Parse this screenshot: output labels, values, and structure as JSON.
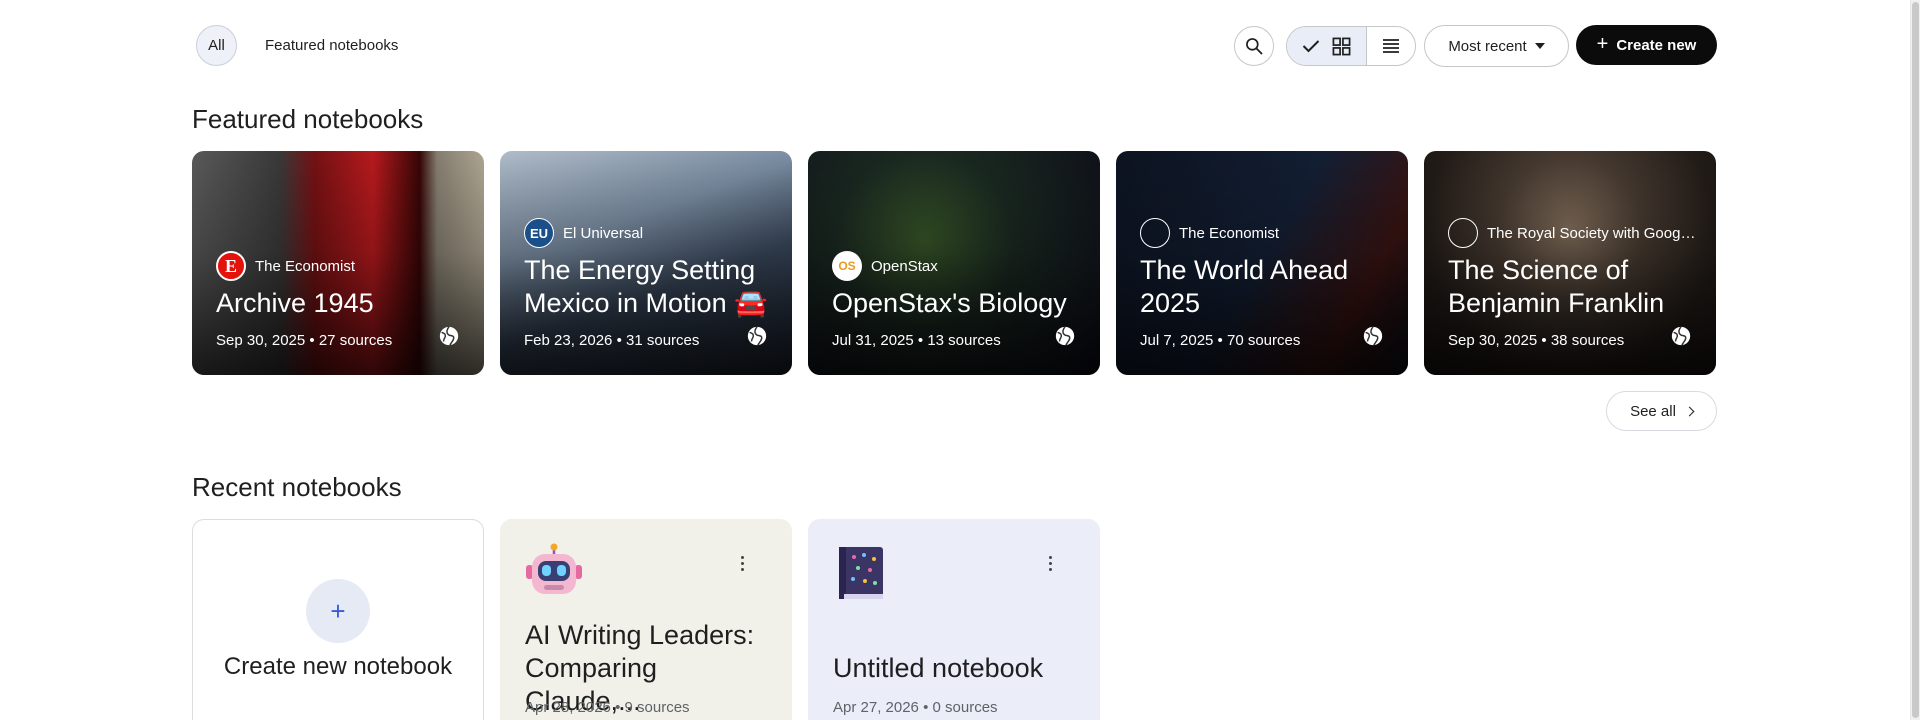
{
  "filters": {
    "all_label": "All",
    "featured_label": "Featured notebooks"
  },
  "toolbar": {
    "sort_label": "Most recent",
    "create_label": "Create new"
  },
  "featured": {
    "title": "Featured notebooks",
    "cards": [
      {
        "publisher": "The Economist",
        "publisher_logo": "E",
        "title": "Archive 1945",
        "date": "Sep 30, 2025",
        "sources": "27 sources"
      },
      {
        "publisher": "El Universal",
        "publisher_logo": "EU",
        "title": "The Energy Setting Mexico in Motion 🚘🚆⚡",
        "date": "Feb 23, 2026",
        "sources": "31 sources"
      },
      {
        "publisher": "OpenStax",
        "publisher_logo": "OS",
        "title": "OpenStax's Biology",
        "date": "Jul 31, 2025",
        "sources": "13 sources"
      },
      {
        "publisher": "The Economist",
        "publisher_logo": "",
        "title": "The World Ahead 2025",
        "date": "Jul 7, 2025",
        "sources": "70 sources"
      },
      {
        "publisher": "The Royal Society with Google...",
        "publisher_logo": "",
        "title": "The Science of Benjamin Franklin",
        "date": "Sep 30, 2025",
        "sources": "38 sources"
      }
    ],
    "see_all": "See all"
  },
  "recent": {
    "title": "Recent notebooks",
    "create_label": "Create new notebook",
    "cards": [
      {
        "icon": "robot-emoji",
        "title": "AI Writing Leaders: Comparing Claude,...",
        "date": "Apr 28, 2026",
        "sources": "9 sources"
      },
      {
        "icon": "book-emoji",
        "title": "Untitled notebook",
        "date": "Apr 27, 2026",
        "sources": "0 sources"
      }
    ]
  },
  "meta_separator": " • ",
  "colors": {
    "create_button": "#0b0b0b",
    "grid_toggle_active": "#e8edf7",
    "untitled_card": "#ebedf8",
    "ai_card": "#f1f1ea"
  }
}
